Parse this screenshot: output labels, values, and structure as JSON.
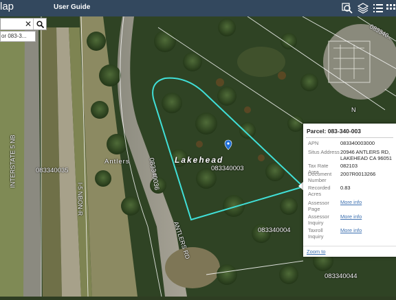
{
  "header": {
    "app_title": "lap",
    "user_guide_label": "User Guide",
    "tools": [
      {
        "icon": "search-zoom-icon"
      },
      {
        "icon": "layers-icon"
      },
      {
        "icon": "list-icon"
      },
      {
        "icon": "grid-icon"
      }
    ],
    "color": "#33485e"
  },
  "search": {
    "query": "",
    "result_text": "or 083-3..."
  },
  "map": {
    "labels": {
      "interstate_nb": "INTERSTATE 5 NB",
      "i5_nb_onr": "I-5 NBON-R",
      "parcel_083340035": "083340035",
      "antlers": "Antlers",
      "lakehead": "Lakehead",
      "parcel_083340036": "083340036",
      "parcel_083340003": "083340003",
      "parcel_083340004": "083340004",
      "parcel_083340044": "083340044",
      "antlers_rd": "ANTLERS RD",
      "parcel_top_right": "083340...",
      "north_marker": "N"
    },
    "parcel_outline_color": "#40e0d8"
  },
  "popup": {
    "title": "Parcel: 083-340-003",
    "fields": [
      {
        "label": "APN",
        "value": "083340003000"
      },
      {
        "label": "Situs Address",
        "value": "20946 ANTLERS RD, LAKEHEAD CA 96051"
      },
      {
        "label": "Tax Rate Area",
        "value": "082103"
      },
      {
        "label": "Document Number",
        "value": "2007R0013266"
      },
      {
        "label": "Recorded Acres",
        "value": "0.83"
      },
      {
        "label": "Assessor Page",
        "value": "More info"
      },
      {
        "label": "Assessor Inquiry",
        "value": "More info"
      },
      {
        "label": "Taxroll Inquiry",
        "value": "More info"
      }
    ],
    "zoom_to": "Zoom to"
  }
}
